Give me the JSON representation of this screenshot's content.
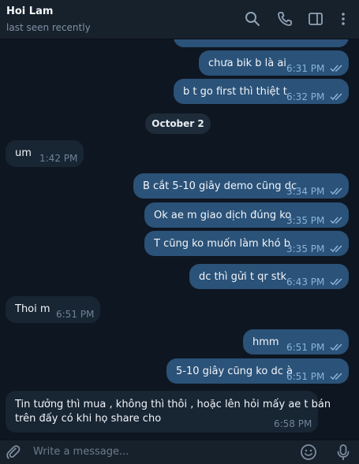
{
  "header": {
    "name": "Hoi Lam",
    "status": "last seen recently"
  },
  "date_divider": "October 2",
  "messages": [
    {
      "text": "chưa bik b là ai",
      "time": "6:31 PM"
    },
    {
      "text": "b t go first thì thiệt t",
      "time": "6:32 PM"
    },
    {
      "text": "um",
      "time": "1:42 PM"
    },
    {
      "text": "B cắt 5-10 giây demo cũng dc",
      "time": "3:34 PM"
    },
    {
      "text": "Ok ae m giao dịch đúng ko",
      "time": "3:35 PM"
    },
    {
      "text": "T cũng ko muốn làm khó b",
      "time": "3:35 PM"
    },
    {
      "text": "dc thì gửi t qr stk",
      "time": "6:43 PM"
    },
    {
      "text": "Thoi m",
      "time": "6:51 PM"
    },
    {
      "text": "hmm",
      "time": "6:51 PM"
    },
    {
      "text": "5-10 giây cũng ko dc à",
      "time": "6:51 PM"
    },
    {
      "text_line1": "Tin tưởng thì mua , không thì thôi , hoặc lên hỏi mấy ae t bán",
      "text_line2": "trên đấy có khi họ share cho",
      "time": "6:58 PM"
    }
  ],
  "input": {
    "placeholder": "Write a message..."
  },
  "colors": {
    "background": "#0e1621",
    "header": "#17212b",
    "outgoing_bubble": "#2b5278",
    "incoming_bubble": "#182533",
    "read_check": "#8ab4dd"
  },
  "icons": [
    "search-icon",
    "phone-icon",
    "sidebar-toggle-icon",
    "more-icon",
    "attach-icon",
    "emoji-icon",
    "microphone-icon",
    "double-check-icon"
  ]
}
